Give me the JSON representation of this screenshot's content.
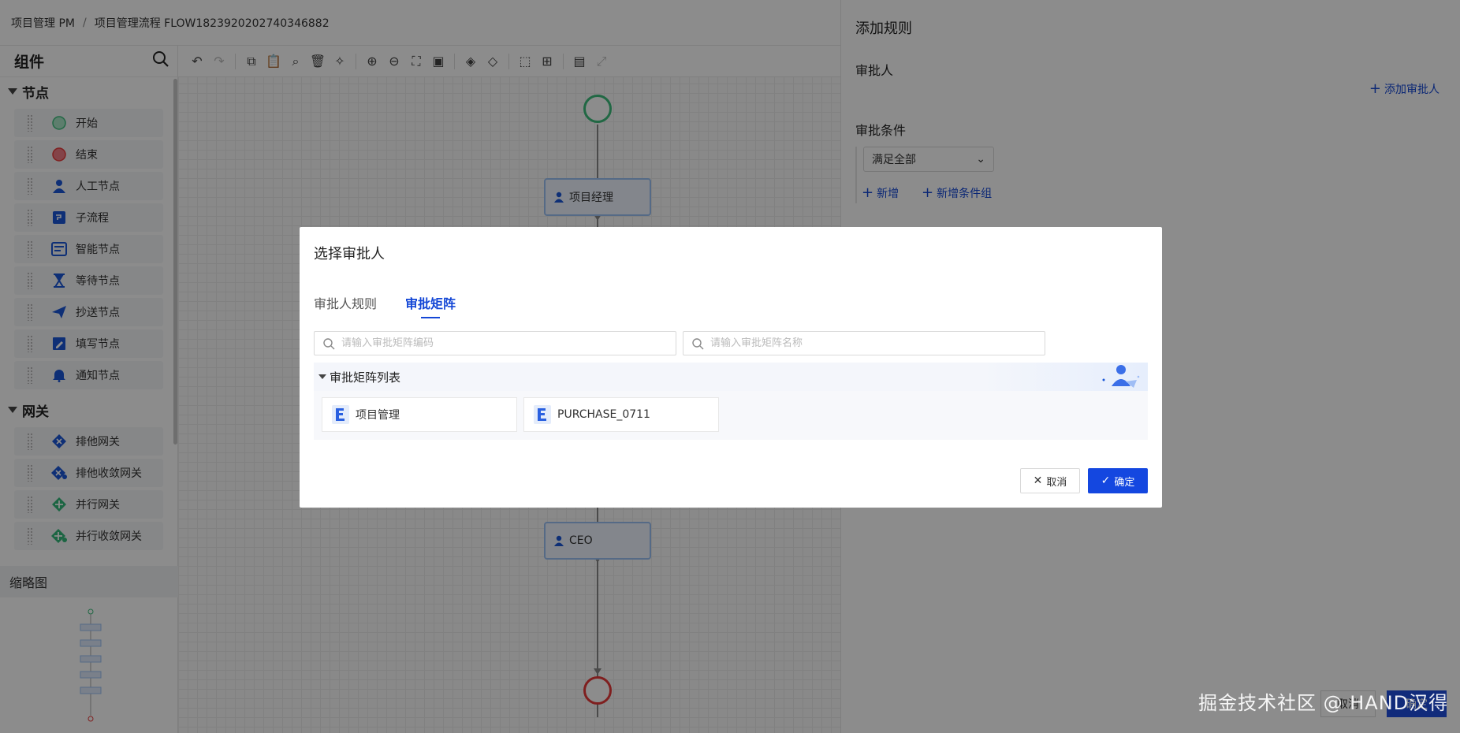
{
  "breadcrumb": {
    "items": [
      "项目管理 PM",
      "项目管理流程 FLOW1823920202740346882"
    ],
    "separator": "/"
  },
  "components": {
    "title": "组件",
    "nodes_group": "节点",
    "nodes": [
      {
        "label": "开始",
        "icon": "start-circle-icon"
      },
      {
        "label": "结束",
        "icon": "end-circle-icon"
      },
      {
        "label": "人工节点",
        "icon": "user-icon"
      },
      {
        "label": "子流程",
        "icon": "subprocess-icon"
      },
      {
        "label": "智能节点",
        "icon": "smart-node-icon"
      },
      {
        "label": "等待节点",
        "icon": "hourglass-icon"
      },
      {
        "label": "抄送节点",
        "icon": "send-icon"
      },
      {
        "label": "填写节点",
        "icon": "edit-icon"
      },
      {
        "label": "通知节点",
        "icon": "bell-icon"
      }
    ],
    "gateways_group": "网关",
    "gateways": [
      {
        "label": "排他网关",
        "icon": "exclusive-gateway-icon"
      },
      {
        "label": "排他收敛网关",
        "icon": "exclusive-converge-gateway-icon"
      },
      {
        "label": "并行网关",
        "icon": "parallel-gateway-icon"
      },
      {
        "label": "并行收敛网关",
        "icon": "parallel-converge-gateway-icon"
      }
    ],
    "thumbnail_title": "缩略图"
  },
  "flow": {
    "node1": "项目经理",
    "node2": "CEO"
  },
  "right_panel": {
    "title": "添加规则",
    "approver_label": "审批人",
    "add_approver": "添加审批人",
    "condition_label": "审批条件",
    "condition_select": "满足全部",
    "add_link": "新增",
    "add_group_link": "新增条件组",
    "footer_cancel": "取消",
    "footer_ok": "确定"
  },
  "modal": {
    "title": "选择审批人",
    "tabs": [
      {
        "label": "审批人规则",
        "active": false
      },
      {
        "label": "审批矩阵",
        "active": true
      }
    ],
    "search_code_placeholder": "请输入审批矩阵编码",
    "search_name_placeholder": "请输入审批矩阵名称",
    "list_title": "审批矩阵列表",
    "matrices": [
      {
        "name": "项目管理"
      },
      {
        "name": "PURCHASE_0711"
      }
    ],
    "cancel": "取消",
    "confirm": "确定"
  },
  "watermark": "掘金技术社区 @ HAND汉得",
  "colors": {
    "accent": "#1447e0",
    "start": "#3dbd7d",
    "end": "#e83a3a",
    "node_border": "#9bc1f4"
  }
}
